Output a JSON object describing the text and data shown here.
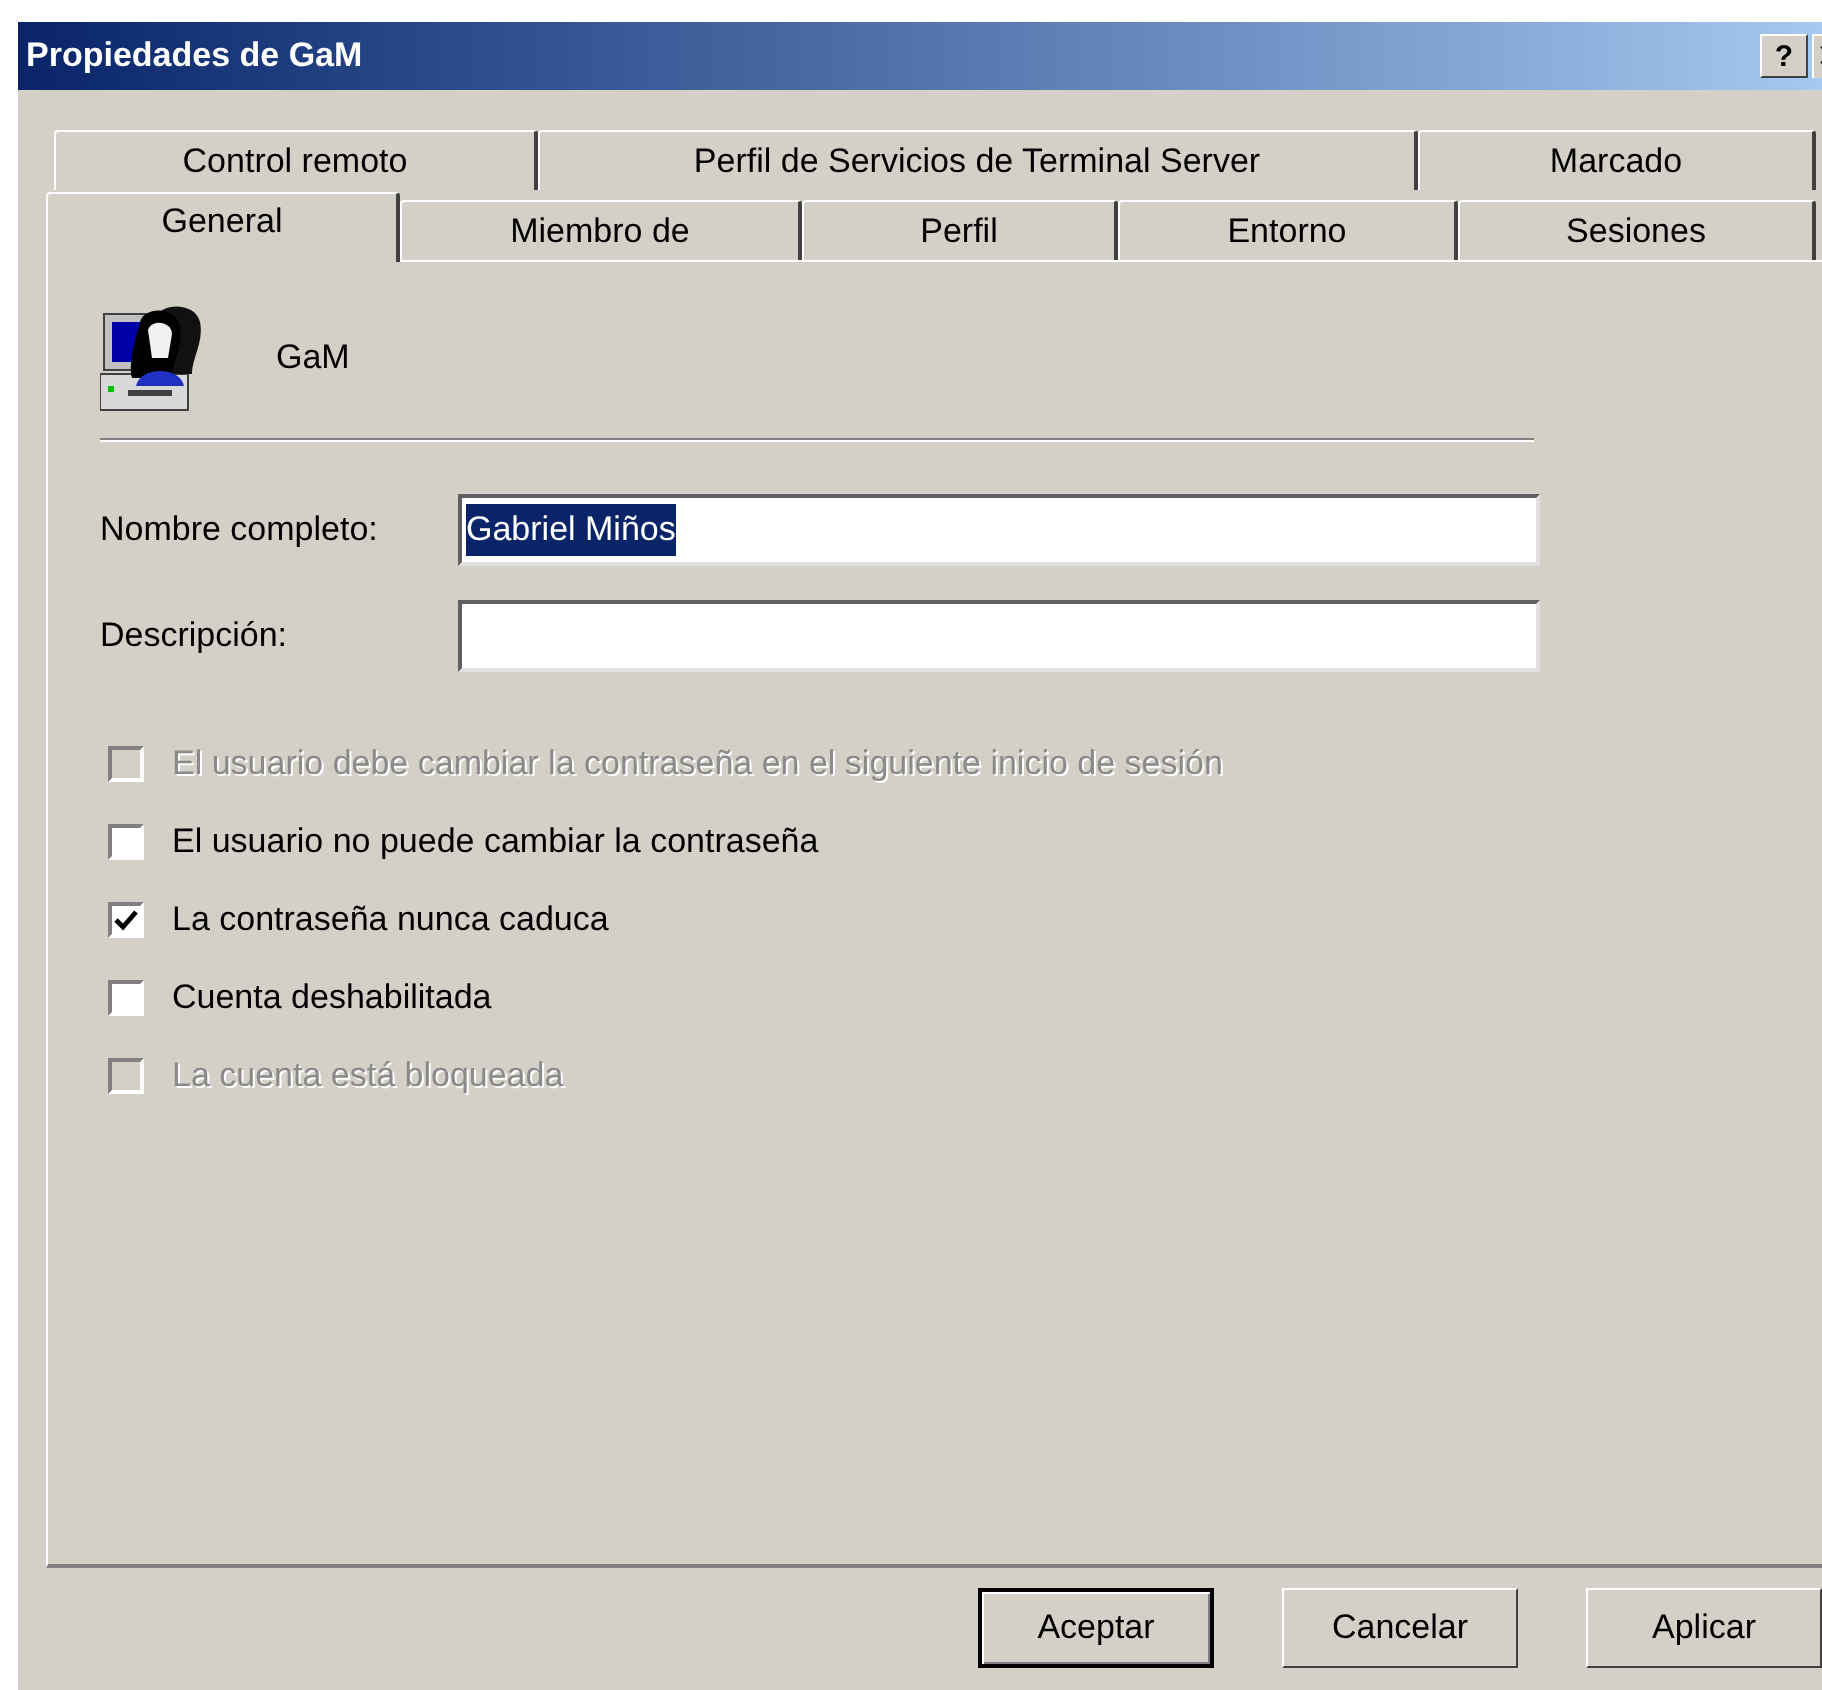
{
  "window": {
    "title": "Propiedades de GaM",
    "help_button": "?"
  },
  "tab_rows": [
    [
      {
        "label": "Control remoto",
        "selected": false
      },
      {
        "label": "Perfil de Servicios de Terminal Server",
        "selected": false
      },
      {
        "label": "Marcado",
        "selected": false
      }
    ],
    [
      {
        "label": "General",
        "selected": true
      },
      {
        "label": "Miembro de",
        "selected": false
      },
      {
        "label": "Perfil",
        "selected": false
      },
      {
        "label": "Entorno",
        "selected": false
      },
      {
        "label": "Sesiones",
        "selected": false
      }
    ]
  ],
  "user": {
    "name": "GaM"
  },
  "fields": [
    {
      "label": "Nombre completo:",
      "value": "Gabriel Miños",
      "highlighted": true
    },
    {
      "label": "Descripción:"
    }
  ],
  "checkboxes": [
    {
      "label": "El usuario debe cambiar la contraseña en el siguiente inicio de sesión",
      "checked": false,
      "disabled": true
    },
    {
      "label": "El usuario no puede cambiar la contraseña",
      "checked": false,
      "disabled": false
    },
    {
      "label": "La contraseña nunca caduca",
      "checked": true,
      "disabled": false
    },
    {
      "label": "Cuenta deshabilitada",
      "checked": false,
      "disabled": false
    },
    {
      "label": "La cuenta está bloqueada",
      "checked": false,
      "disabled": true
    }
  ],
  "buttons": [
    {
      "label": "Aceptar",
      "default": true
    },
    {
      "label": "Cancelar",
      "default": false
    },
    {
      "label": "Aplicar",
      "default": false
    }
  ]
}
